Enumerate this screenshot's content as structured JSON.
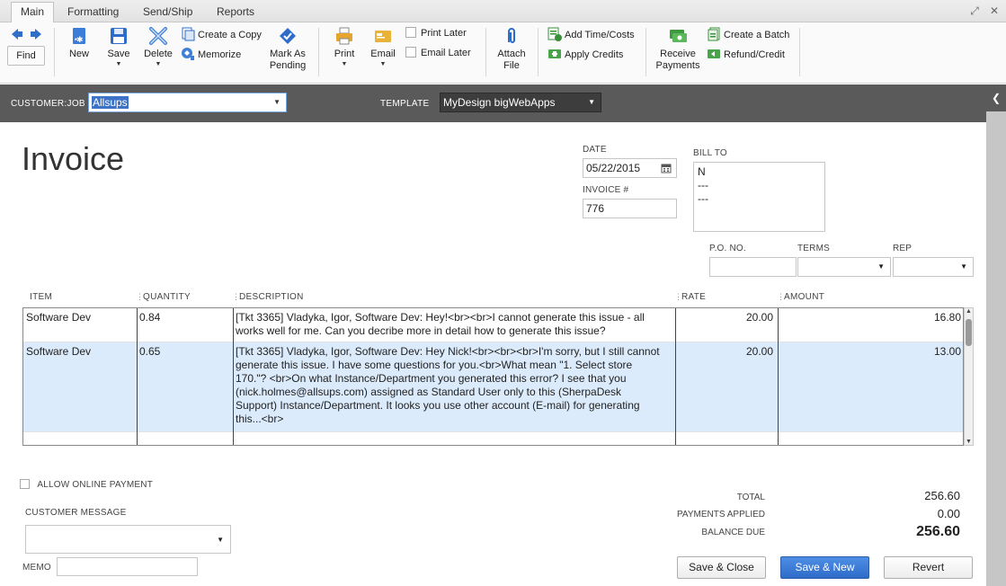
{
  "tabs": [
    "Main",
    "Formatting",
    "Send/Ship",
    "Reports"
  ],
  "toolbar": {
    "find": "Find",
    "new": "New",
    "save": "Save",
    "delete": "Delete",
    "create_copy": "Create a Copy",
    "memorize": "Memorize",
    "mark_as_pending_1": "Mark As",
    "mark_as_pending_2": "Pending",
    "print": "Print",
    "email": "Email",
    "print_later": "Print Later",
    "email_later": "Email Later",
    "attach_1": "Attach",
    "attach_2": "File",
    "add_time_costs": "Add Time/Costs",
    "apply_credits": "Apply Credits",
    "receive_1": "Receive",
    "receive_2": "Payments",
    "create_batch": "Create a Batch",
    "refund_credit": "Refund/Credit"
  },
  "customer_bar": {
    "customer_job_label": "CUSTOMER:JOB",
    "customer_job_value": "Allsups",
    "template_label": "TEMPLATE",
    "template_value": "MyDesign bigWebApps"
  },
  "form": {
    "title": "Invoice",
    "date_label": "DATE",
    "date_value": "05/22/2015",
    "invoice_no_label": "INVOICE #",
    "invoice_no_value": "776",
    "bill_to_label": "BILL TO",
    "bill_to_lines": [
      "N",
      "---",
      "---"
    ],
    "po_label": "P.O. NO.",
    "terms_label": "TERMS",
    "rep_label": "REP"
  },
  "table": {
    "headers": [
      "ITEM",
      "QUANTITY",
      "DESCRIPTION",
      "RATE",
      "AMOUNT"
    ],
    "rows": [
      {
        "item": "Software Dev",
        "quantity": "0.84",
        "description_lines": [
          "[Tkt 3365] Vladyka, Igor, Software Dev: Hey!<br><br>I cannot generate this issue - all",
          "works well for me. Can you decribe more in detail how to generate this issue?"
        ],
        "rate": "20.00",
        "amount": "16.80"
      },
      {
        "item": "Software Dev",
        "quantity": "0.65",
        "description_lines": [
          "[Tkt 3365] Vladyka, Igor, Software Dev: Hey Nick!<br><br><br>I'm sorry, but I still cannot",
          "generate this issue. I have some questions for you.<br>What mean \"1.       Select store",
          "170.\"? <br>On what Instance/Department you generated this error? I see that you",
          "(nick.holmes@allsups.com) assigned as Standard User only to this (SherpaDesk",
          "Support) Instance/Department. It looks you use other account (E-mail) for generating",
          "this...<br>"
        ],
        "rate": "20.00",
        "amount": "13.00"
      }
    ]
  },
  "bottom": {
    "allow_online_payment": "ALLOW ONLINE PAYMENT",
    "customer_message_label": "CUSTOMER MESSAGE",
    "memo_label": "MEMO",
    "total_label": "TOTAL",
    "total_value": "256.60",
    "payments_applied_label": "PAYMENTS APPLIED",
    "payments_applied_value": "0.00",
    "balance_due_label": "BALANCE DUE",
    "balance_due_value": "256.60",
    "save_close": "Save & Close",
    "save_new": "Save & New",
    "revert": "Revert"
  },
  "colors": {
    "accent": "#2d6cc9",
    "selected_row": "#dcebfb",
    "header_bar": "#5a5a5a"
  }
}
